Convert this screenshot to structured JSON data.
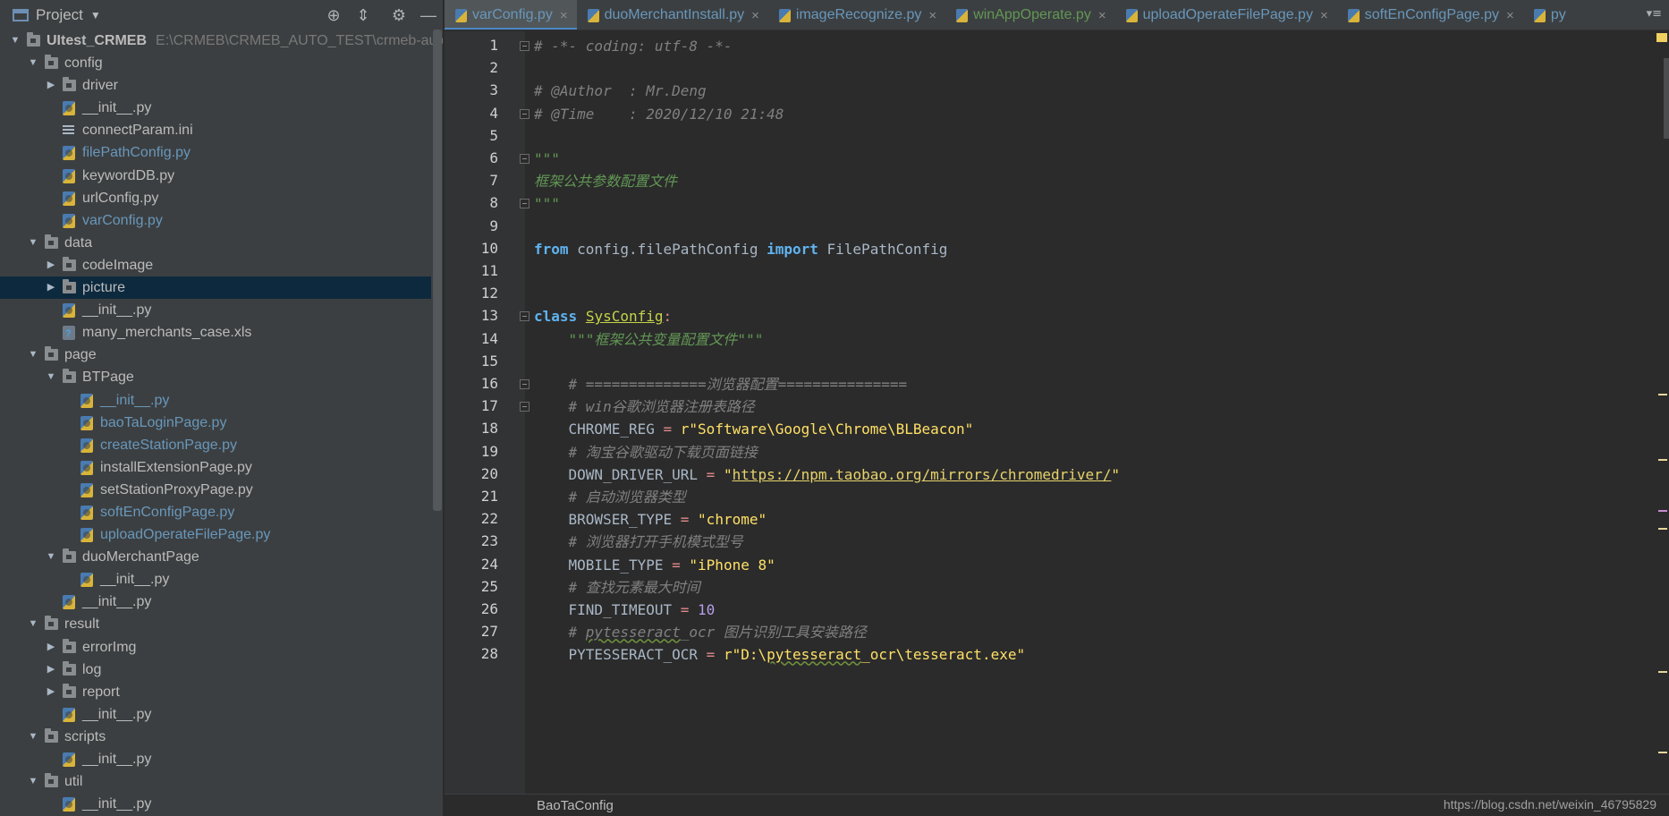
{
  "panel": {
    "title": "Project"
  },
  "tree": [
    {
      "label": "UItest_CRMEB",
      "sub": "E:\\CRMEB\\CRMEB_AUTO_TEST\\crmeb-auto-te",
      "depth": 0,
      "type": "root",
      "arrow": "down"
    },
    {
      "label": "config",
      "depth": 1,
      "type": "folder",
      "arrow": "down"
    },
    {
      "label": "driver",
      "depth": 2,
      "type": "folder",
      "arrow": "right"
    },
    {
      "label": "__init__.py",
      "depth": 2,
      "type": "py"
    },
    {
      "label": "connectParam.ini",
      "depth": 2,
      "type": "ini"
    },
    {
      "label": "filePathConfig.py",
      "depth": 2,
      "type": "py",
      "modified": true
    },
    {
      "label": "keywordDB.py",
      "depth": 2,
      "type": "py"
    },
    {
      "label": "urlConfig.py",
      "depth": 2,
      "type": "py"
    },
    {
      "label": "varConfig.py",
      "depth": 2,
      "type": "py",
      "modified": true
    },
    {
      "label": "data",
      "depth": 1,
      "type": "folder",
      "arrow": "down"
    },
    {
      "label": "codeImage",
      "depth": 2,
      "type": "folder",
      "arrow": "right"
    },
    {
      "label": "picture",
      "depth": 2,
      "type": "folder",
      "arrow": "right",
      "selected": true
    },
    {
      "label": "__init__.py",
      "depth": 2,
      "type": "py"
    },
    {
      "label": "many_merchants_case.xls",
      "depth": 2,
      "type": "xls"
    },
    {
      "label": "page",
      "depth": 1,
      "type": "folder",
      "arrow": "down"
    },
    {
      "label": "BTPage",
      "depth": 2,
      "type": "folder",
      "arrow": "down"
    },
    {
      "label": "__init__.py",
      "depth": 3,
      "type": "py",
      "modified": true
    },
    {
      "label": "baoTaLoginPage.py",
      "depth": 3,
      "type": "py",
      "modified": true
    },
    {
      "label": "createStationPage.py",
      "depth": 3,
      "type": "py",
      "modified": true
    },
    {
      "label": "installExtensionPage.py",
      "depth": 3,
      "type": "py"
    },
    {
      "label": "setStationProxyPage.py",
      "depth": 3,
      "type": "py"
    },
    {
      "label": "softEnConfigPage.py",
      "depth": 3,
      "type": "py",
      "modified": true
    },
    {
      "label": "uploadOperateFilePage.py",
      "depth": 3,
      "type": "py",
      "modified": true
    },
    {
      "label": "duoMerchantPage",
      "depth": 2,
      "type": "folder",
      "arrow": "down"
    },
    {
      "label": "__init__.py",
      "depth": 3,
      "type": "py"
    },
    {
      "label": "__init__.py",
      "depth": 2,
      "type": "py"
    },
    {
      "label": "result",
      "depth": 1,
      "type": "folder",
      "arrow": "down"
    },
    {
      "label": "errorImg",
      "depth": 2,
      "type": "folder",
      "arrow": "right"
    },
    {
      "label": "log",
      "depth": 2,
      "type": "folder",
      "arrow": "right"
    },
    {
      "label": "report",
      "depth": 2,
      "type": "folder",
      "arrow": "right"
    },
    {
      "label": "__init__.py",
      "depth": 2,
      "type": "py"
    },
    {
      "label": "scripts",
      "depth": 1,
      "type": "folder",
      "arrow": "down"
    },
    {
      "label": "__init__.py",
      "depth": 2,
      "type": "py"
    },
    {
      "label": "util",
      "depth": 1,
      "type": "folder",
      "arrow": "down"
    },
    {
      "label": "__init__.py",
      "depth": 2,
      "type": "py"
    }
  ],
  "tabs": [
    {
      "label": "varConfig.py",
      "active": true,
      "closable": true
    },
    {
      "label": "duoMerchantInstall.py",
      "closable": true
    },
    {
      "label": "imageRecognize.py",
      "closable": true
    },
    {
      "label": "winAppOperate.py",
      "closable": true,
      "green": true
    },
    {
      "label": "uploadOperateFilePage.py",
      "closable": true
    },
    {
      "label": "softEnConfigPage.py",
      "closable": true
    },
    {
      "label": "py",
      "closable": false
    }
  ],
  "tab_menu_icon": "tab-list-icon",
  "code_lines": [
    [
      [
        "cmt",
        "# -*- coding: utf-8 -*-"
      ]
    ],
    [],
    [
      [
        "cmt",
        "# @Author  : Mr.Deng"
      ]
    ],
    [
      [
        "cmt",
        "# @Time    : 2020/12/10 21:48"
      ]
    ],
    [],
    [
      [
        "doc",
        "\"\"\""
      ]
    ],
    [
      [
        "doc",
        "框架公共参数配置文件"
      ]
    ],
    [
      [
        "doc",
        "\"\"\""
      ]
    ],
    [],
    [
      [
        "kw2",
        "from"
      ],
      [
        "txt",
        " config.filePathConfig "
      ],
      [
        "kw2",
        "import"
      ],
      [
        "txt",
        " FilePathConfig"
      ]
    ],
    [],
    [],
    [
      [
        "kw2",
        "class"
      ],
      [
        "txt",
        " "
      ],
      [
        "cls-name",
        "SysConfig"
      ],
      [
        "op",
        ":"
      ]
    ],
    [
      [
        "txt",
        "    "
      ],
      [
        "doc",
        "\"\"\"框架公共变量配置文件\"\"\""
      ]
    ],
    [],
    [
      [
        "txt",
        "    "
      ],
      [
        "cmt",
        "# ==============浏览器配置==============="
      ]
    ],
    [
      [
        "txt",
        "    "
      ],
      [
        "cmt",
        "# win谷歌浏览器注册表路径"
      ]
    ],
    [
      [
        "txt",
        "    CHROME_REG "
      ],
      [
        "op",
        "="
      ],
      [
        "txt",
        " "
      ],
      [
        "str",
        "r\"Software\\Google\\Chrome\\BLBeacon\""
      ]
    ],
    [
      [
        "txt",
        "    "
      ],
      [
        "cmt",
        "# 淘宝谷歌驱动下载页面链接"
      ]
    ],
    [
      [
        "txt",
        "    DOWN_DRIVER_URL "
      ],
      [
        "op",
        "="
      ],
      [
        "txt",
        " "
      ],
      [
        "str",
        "\""
      ],
      [
        "url",
        "https://npm.taobao.org/mirrors/chromedriver/"
      ],
      [
        "str",
        "\""
      ]
    ],
    [
      [
        "txt",
        "    "
      ],
      [
        "cmt",
        "# 启动浏览器类型"
      ]
    ],
    [
      [
        "txt",
        "    BROWSER_TYPE "
      ],
      [
        "op",
        "="
      ],
      [
        "txt",
        " "
      ],
      [
        "str",
        "\"chrome\""
      ]
    ],
    [
      [
        "txt",
        "    "
      ],
      [
        "cmt",
        "# 浏览器打开手机模式型号"
      ]
    ],
    [
      [
        "txt",
        "    MOBILE_TYPE "
      ],
      [
        "op",
        "="
      ],
      [
        "txt",
        " "
      ],
      [
        "str",
        "\"iPhone 8\""
      ]
    ],
    [
      [
        "txt",
        "    "
      ],
      [
        "cmt",
        "# 查找元素最大时间"
      ]
    ],
    [
      [
        "txt",
        "    FIND_TIMEOUT "
      ],
      [
        "op",
        "="
      ],
      [
        "txt",
        " "
      ],
      [
        "num",
        "10"
      ]
    ],
    [
      [
        "txt",
        "    "
      ],
      [
        "cmt",
        "# "
      ],
      [
        "cmt-squig",
        "pytesseract"
      ],
      [
        "cmt",
        "_ocr 图片识别工具安装路径"
      ]
    ],
    [
      [
        "txt",
        "    PYTESSERACT_OCR "
      ],
      [
        "op",
        "="
      ],
      [
        "txt",
        " "
      ],
      [
        "str",
        "r\"D:\\"
      ],
      [
        "str-squig",
        "pytesseract"
      ],
      [
        "str",
        "_ocr\\tesseract.exe\""
      ]
    ]
  ],
  "fold_lines": [
    1,
    4,
    6,
    8,
    13,
    16,
    17
  ],
  "status": {
    "breadcrumb": "BaoTaConfig",
    "watermark": "https://blog.csdn.net/weixin_46795829"
  },
  "colors": {
    "panel_bg": "#3c3f41",
    "editor_bg": "#2b2b2b",
    "selection": "#0d293e",
    "accent": "#4a88c7"
  }
}
